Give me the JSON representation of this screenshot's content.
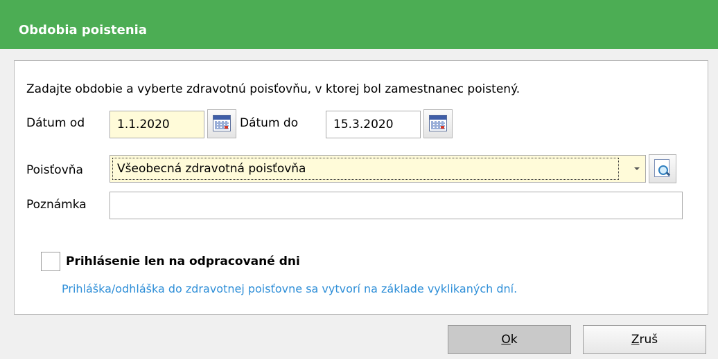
{
  "window": {
    "title": "Obdobia poistenia"
  },
  "form": {
    "intro": "Zadajte obdobie a vyberte zdravotnú poisťovňu, v ktorej bol zamestnanec poistený.",
    "date_from_label": "Dátum od",
    "date_from_value": "1.1.2020",
    "date_to_label": "Dátum do",
    "date_to_value": "15.3.2020",
    "insurer_label": "Poisťovňa",
    "insurer_value": "Všeobecná zdravotná poisťovňa",
    "note_label": "Poznámka",
    "note_value": "",
    "checkbox_label": "Prihlásenie len na odpracované dni",
    "checkbox_checked": false,
    "hint": "Prihláška/odhláška do zdravotnej poisťovne sa vytvorí na základe vyklikaných dní."
  },
  "buttons": {
    "ok_accel": "O",
    "ok_rest": "k",
    "cancel_accel": "Z",
    "cancel_rest": "ruš"
  },
  "colors": {
    "titlebar": "#4cad54",
    "hint_text": "#2f8fd8",
    "required_field": "#fffbd9"
  },
  "icons": [
    "calendar-icon",
    "dropdown-arrow-icon",
    "lookup-icon"
  ]
}
